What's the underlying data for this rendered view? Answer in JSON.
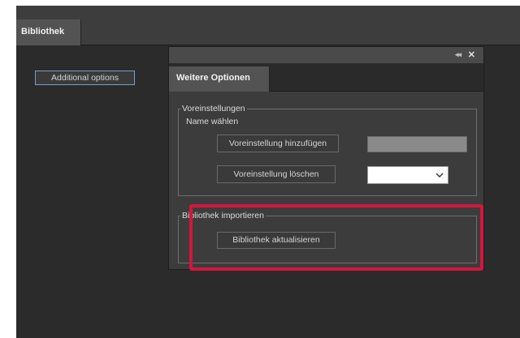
{
  "main": {
    "tab_label": "Bibliothek",
    "additional_options_label": "Additional options"
  },
  "dialog": {
    "collapse_icon": "double-chevron-left-icon",
    "close_icon": "close-icon",
    "tab_label": "Weitere Optionen",
    "presets_group": {
      "legend": "Voreinstellungen",
      "sub_label": "Name wählen",
      "add_button_label": "Voreinstellung hinzufügen",
      "delete_button_label": "Voreinstellung löschen",
      "name_field_value": "",
      "select_value": ""
    },
    "import_group": {
      "legend": "Bibliothek importieren",
      "refresh_button_label": "Bibliothek aktualisieren"
    }
  },
  "colors": {
    "highlight": "#d4163c",
    "panel_bg": "#2b2b2b",
    "dialog_bg": "#3c3c3c",
    "accent_border": "#7a9cc6"
  }
}
